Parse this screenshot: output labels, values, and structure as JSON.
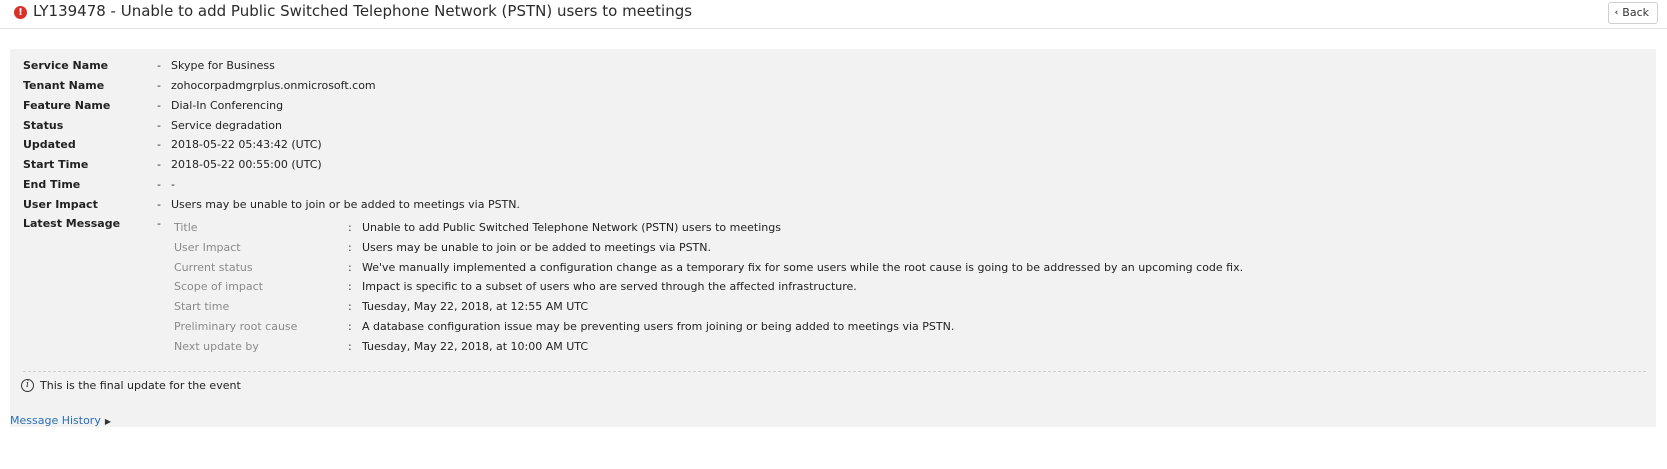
{
  "header": {
    "title": "LY139478 - Unable to add Public Switched Telephone Network (PSTN) users to meetings",
    "back_label": "Back",
    "status_color": "#d9302a"
  },
  "details": [
    {
      "label": "Service Name",
      "value": "Skype for Business"
    },
    {
      "label": "Tenant Name",
      "value": "zohocorpadmgrplus.onmicrosoft.com"
    },
    {
      "label": "Feature Name",
      "value": "Dial-In Conferencing"
    },
    {
      "label": "Status",
      "value": "Service degradation"
    },
    {
      "label": "Updated",
      "value": "2018-05-22 05:43:42 (UTC)"
    },
    {
      "label": "Start Time",
      "value": "2018-05-22 00:55:00 (UTC)"
    },
    {
      "label": "End Time",
      "value": "-"
    },
    {
      "label": "User Impact",
      "value": "Users may be unable to join or be added to meetings via PSTN."
    },
    {
      "label": "Latest Message",
      "value": ""
    }
  ],
  "latest_message": [
    {
      "label": "Title",
      "value": "Unable to add Public Switched Telephone Network (PSTN) users to meetings"
    },
    {
      "label": "User Impact",
      "value": "Users may be unable to join or be added to meetings via PSTN."
    },
    {
      "label": "Current status",
      "value": "We've manually implemented a configuration change as a temporary fix for some users while the root cause is going to be addressed by an upcoming code fix."
    },
    {
      "label": "Scope of impact",
      "value": "Impact is specific to a subset of users who are served through the affected infrastructure."
    },
    {
      "label": "Start time",
      "value": "Tuesday, May 22, 2018, at 12:55 AM UTC"
    },
    {
      "label": "Preliminary root cause",
      "value": "A database configuration issue may be preventing users from joining or being added to meetings via PSTN."
    },
    {
      "label": "Next update by",
      "value": "Tuesday, May 22, 2018, at 10:00 AM UTC"
    }
  ],
  "separators": {
    "dash": "-",
    "colon": ":"
  },
  "footer": {
    "final_note": "This is the final update for the event",
    "history_link": "Message History"
  }
}
